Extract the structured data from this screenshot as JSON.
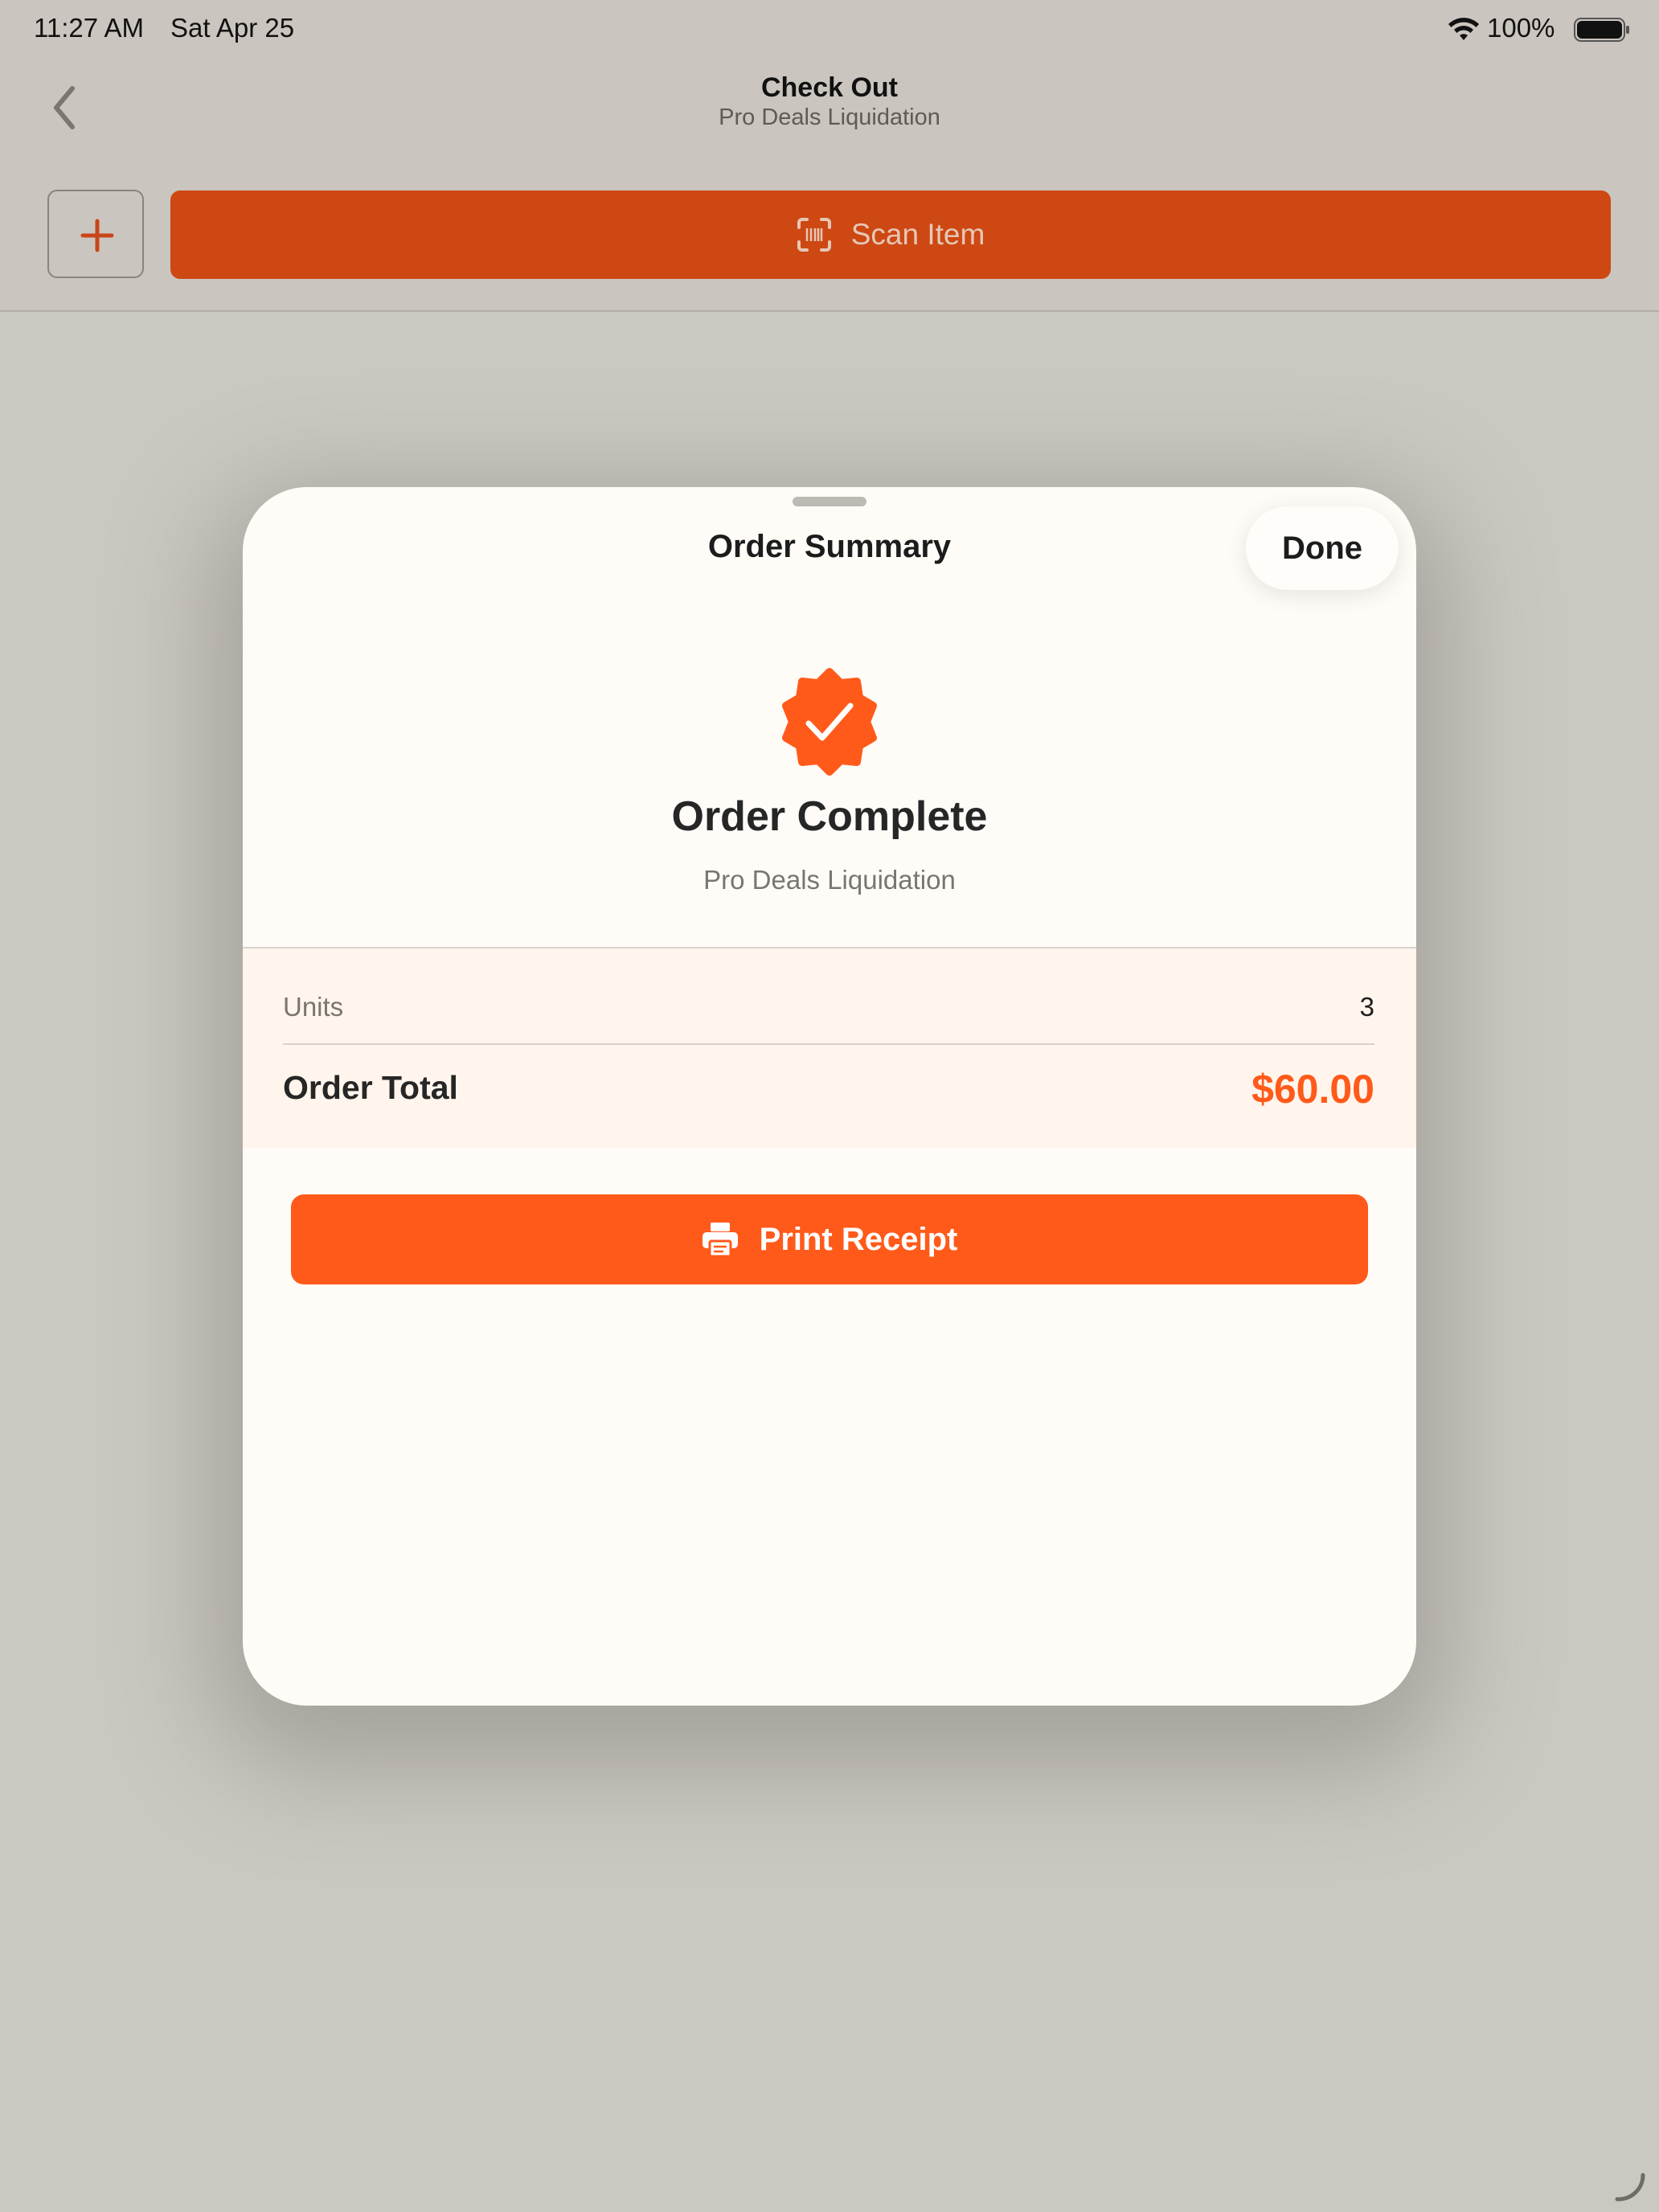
{
  "status_bar": {
    "time": "11:27 AM",
    "date": "Sat Apr 25",
    "battery": "100%"
  },
  "header": {
    "title": "Check Out",
    "subtitle": "Pro Deals Liquidation",
    "scan_label": "Scan Item"
  },
  "modal": {
    "title": "Order Summary",
    "done_label": "Done",
    "status_title": "Order Complete",
    "store_name": "Pro Deals Liquidation",
    "units_label": "Units",
    "units_value": "3",
    "total_label": "Order Total",
    "total_value": "$60.00",
    "print_label": "Print Receipt"
  },
  "icons": {
    "back": "chevron-left-icon",
    "add": "plus-icon",
    "scan": "barcode-scan-icon",
    "seal": "checkmark-seal-icon",
    "print": "printer-icon",
    "wifi": "wifi-icon",
    "battery": "battery-icon"
  },
  "colors": {
    "accent": "#ff5a1a",
    "scan_button": "#cd4813",
    "background": "#cbc8c2",
    "sheet": "#fffcf7",
    "summary_panel": "#fff5ec"
  }
}
